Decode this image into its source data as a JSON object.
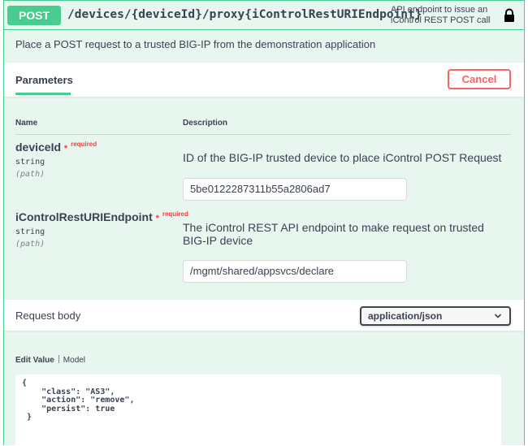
{
  "operation": {
    "method": "POST",
    "path": "/devices/{deviceId}/proxy{iControlRestURIEndpoint}",
    "summary": "API endpoint to issue an iControl REST POST call",
    "description": "Place a POST request to a trusted BIG-IP from the demonstration application",
    "lock_icon": "lock-icon"
  },
  "parameters": {
    "tab_label": "Parameters",
    "cancel_label": "Cancel",
    "col_name": "Name",
    "col_description": "Description",
    "items": [
      {
        "name": "deviceId",
        "star": "*",
        "required": "required",
        "type": "string",
        "in": "(path)",
        "description": "ID of the BIG-IP trusted device to place iControl POST Request",
        "value": "5be0122287311b55a2806ad7"
      },
      {
        "name": "iControlRestURIEndpoint",
        "star": "*",
        "required": "required",
        "type": "string",
        "in": "(path)",
        "description": "The iControl REST API endpoint to make request on trusted BIG-IP device",
        "value": "/mgmt/shared/appsvcs/declare"
      }
    ]
  },
  "request_body": {
    "title": "Request body",
    "content_type": "application/json",
    "tab_edit": "Edit Value",
    "tab_model": "Model",
    "value": "{\n    \"class\": \"AS3\",\n    \"action\": \"remove\",\n    \"persist\": true\n }"
  },
  "colors": {
    "post_green": "#49cc90",
    "cancel_red": "#ff6060",
    "block_bg": "#e8f6f0"
  }
}
